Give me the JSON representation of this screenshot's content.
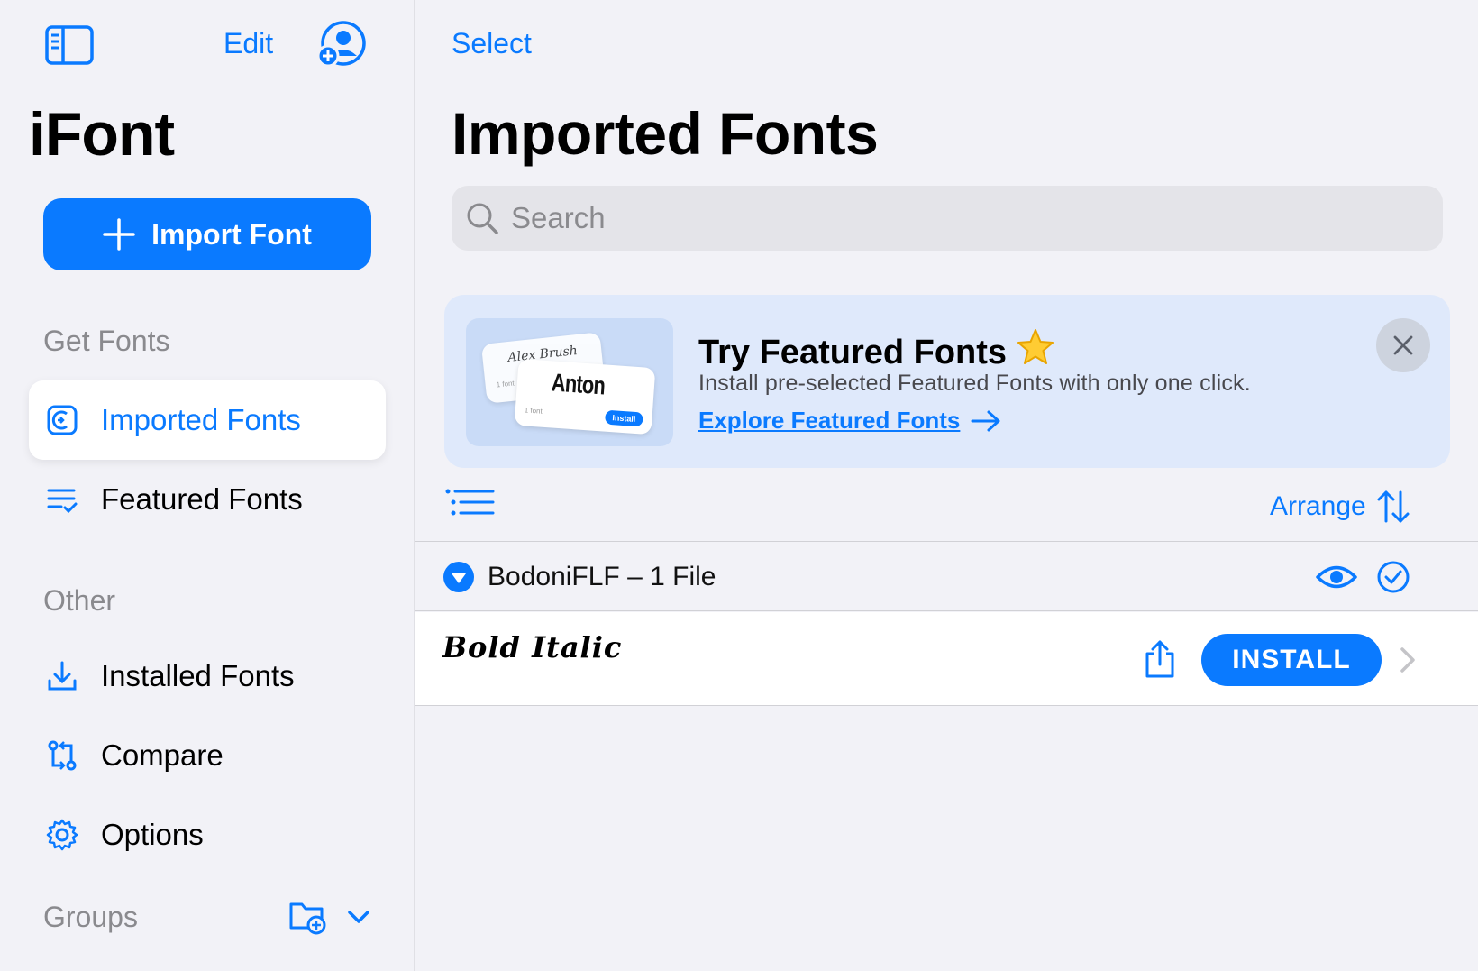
{
  "sidebar": {
    "edit_label": "Edit",
    "app_title": "iFont",
    "import_label": "Import Font",
    "section_get": "Get Fonts",
    "section_other": "Other",
    "section_groups": "Groups",
    "items": [
      {
        "label": "Imported Fonts",
        "icon": "imported-fonts-icon",
        "active": true
      },
      {
        "label": "Featured Fonts",
        "icon": "featured-fonts-icon",
        "active": false
      },
      {
        "label": "Installed Fonts",
        "icon": "download-icon",
        "active": false
      },
      {
        "label": "Compare",
        "icon": "compare-icon",
        "active": false
      },
      {
        "label": "Options",
        "icon": "gear-icon",
        "active": false
      }
    ]
  },
  "main": {
    "select_label": "Select",
    "title": "Imported Fonts",
    "search_placeholder": "Search",
    "promo": {
      "title": "Try Featured Fonts",
      "description": "Install pre-selected Featured Fonts with only one click.",
      "link": "Explore Featured Fonts",
      "thumb_back_font": "Alex Brush",
      "thumb_back_sub": "1 font",
      "thumb_front_font": "Anton",
      "thumb_front_sub": "1 font",
      "thumb_front_btn": "Install"
    },
    "arrange_label": "Arrange",
    "group": {
      "name": "BodoniFLF – 1 File"
    },
    "font": {
      "style": "Bold Italic",
      "install_label": "INSTALL"
    }
  },
  "colors": {
    "accent": "#0a7aff",
    "background": "#f2f2f7",
    "banner": "#dfe9fb"
  }
}
